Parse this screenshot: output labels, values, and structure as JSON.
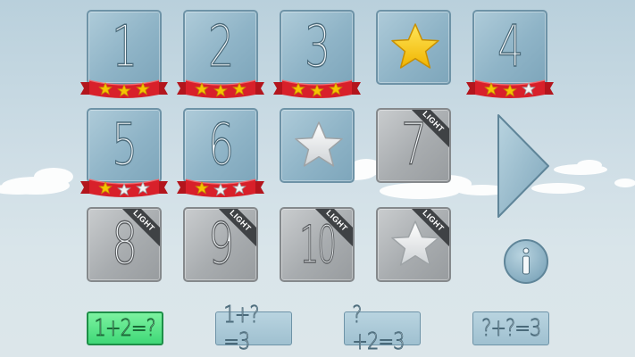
{
  "levels": [
    {
      "label": "1",
      "stars": 3,
      "locked": false,
      "badge": ""
    },
    {
      "label": "2",
      "stars": 3,
      "locked": false,
      "badge": ""
    },
    {
      "label": "3",
      "stars": 3,
      "locked": false,
      "badge": ""
    },
    {
      "label": "bonus-star",
      "stars": null,
      "locked": false,
      "badge": ""
    },
    {
      "label": "4",
      "stars": 2,
      "locked": false,
      "badge": ""
    },
    {
      "label": "5",
      "stars": 1,
      "locked": false,
      "badge": ""
    },
    {
      "label": "6",
      "stars": 1,
      "locked": false,
      "badge": ""
    },
    {
      "label": "bonus-star-gray",
      "stars": null,
      "locked": false,
      "badge": ""
    },
    {
      "label": "7",
      "stars": null,
      "locked": true,
      "badge": "LIGHT"
    },
    {
      "label": "8",
      "stars": null,
      "locked": true,
      "badge": "LIGHT"
    },
    {
      "label": "9",
      "stars": null,
      "locked": true,
      "badge": "LIGHT"
    },
    {
      "label": "10",
      "stars": null,
      "locked": true,
      "badge": "LIGHT"
    },
    {
      "label": "bonus-star-locked",
      "stars": null,
      "locked": true,
      "badge": "LIGHT"
    }
  ],
  "tiles": {
    "t1": "1",
    "t2": "2",
    "t3": "3",
    "t4": "4",
    "t5": "5",
    "t6": "6",
    "t7": "7",
    "t8": "8",
    "t9": "9",
    "t10": "10"
  },
  "badge_text": "LIGHT",
  "modes": [
    {
      "label": "1+2=?",
      "selected": true
    },
    {
      "label": "1+?=3",
      "selected": false
    },
    {
      "label": "?+2=3",
      "selected": false
    },
    {
      "label": "?+?=3",
      "selected": false
    }
  ],
  "colors": {
    "star_gold": "#f5c400",
    "star_silver": "#f2f2f2",
    "ribbon_red": "#d8202a",
    "tile_blue": "#8fb4c7",
    "tile_gray": "#a8acaf",
    "mode_active": "#3fd877"
  },
  "icons": {
    "next": "next-arrow-icon",
    "info": "info-icon"
  }
}
